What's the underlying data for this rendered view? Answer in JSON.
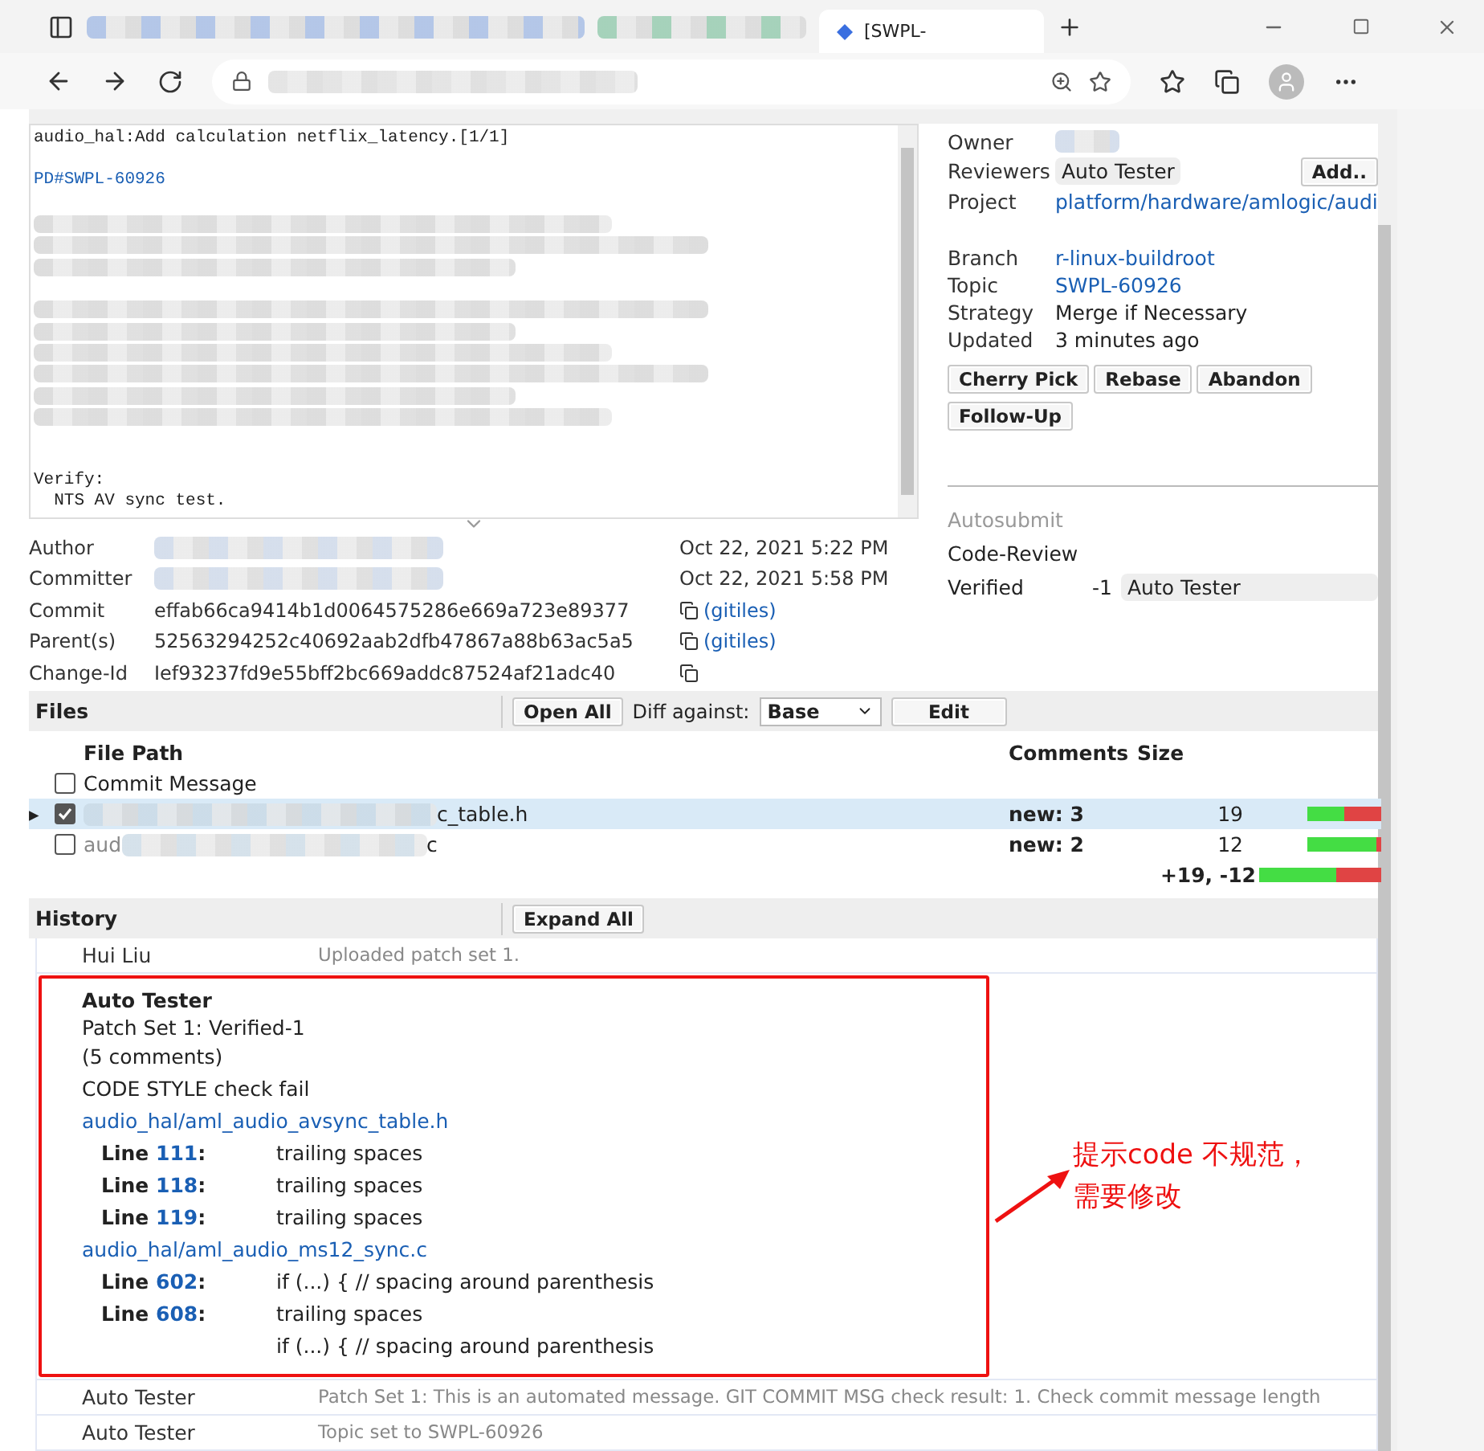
{
  "browser": {
    "tabs": [
      {
        "label": "[SWPL-",
        "selected": true
      }
    ]
  },
  "commit_message": {
    "lines": [
      {
        "kind": "text",
        "text": "audio_hal:Add calculation netflix_latency.[1/1]"
      },
      {
        "kind": "blank"
      },
      {
        "kind": "link",
        "text": "PD#SWPL-60926"
      },
      {
        "kind": "blank"
      },
      {
        "kind": "redacted"
      },
      {
        "kind": "redacted"
      },
      {
        "kind": "redacted"
      },
      {
        "kind": "blank"
      },
      {
        "kind": "redacted"
      },
      {
        "kind": "redacted"
      },
      {
        "kind": "redacted"
      },
      {
        "kind": "redacted"
      },
      {
        "kind": "redacted"
      },
      {
        "kind": "redacted"
      },
      {
        "kind": "blank"
      },
      {
        "kind": "blank"
      },
      {
        "kind": "text",
        "text": "Verify:"
      },
      {
        "kind": "text",
        "text": "  NTS AV sync test."
      }
    ]
  },
  "change_info": {
    "rows": [
      {
        "label": "Owner",
        "kind": "redacted"
      },
      {
        "label": "Reviewers",
        "kind": "chip",
        "value": "Auto Tester",
        "button": "Add.."
      },
      {
        "label": "Project",
        "kind": "link",
        "value": "platform/hardware/amlogic/audi"
      },
      {
        "kind": "blank"
      },
      {
        "label": "Branch",
        "kind": "link",
        "value": "r-linux-buildroot"
      },
      {
        "label": "Topic",
        "kind": "link",
        "value": "SWPL-60926"
      },
      {
        "label": "Strategy",
        "kind": "text",
        "value": "Merge if Necessary"
      },
      {
        "label": "Updated",
        "kind": "text",
        "value": "3 minutes ago"
      }
    ],
    "actions": [
      "Cherry Pick",
      "Rebase",
      "Abandon",
      "Follow-Up"
    ],
    "labels": [
      {
        "name": "Autosubmit",
        "disabled": true
      },
      {
        "name": "Code-Review",
        "disabled": false
      },
      {
        "name": "Verified",
        "disabled": false,
        "score": "-1",
        "voter": "Auto Tester"
      }
    ]
  },
  "commit_info": [
    {
      "label": "Author",
      "kind": "redacted",
      "date": "Oct 22, 2021 5:22 PM"
    },
    {
      "label": "Committer",
      "kind": "redacted",
      "date": "Oct 22, 2021 5:58 PM"
    },
    {
      "label": "Commit",
      "kind": "hash",
      "value": "effab66ca9414b1d0064575286e669a723e89377",
      "link": "(gitiles)"
    },
    {
      "label": "Parent(s)",
      "kind": "hash",
      "value": "52563294252c40692aab2dfb47867a88b63ac5a5",
      "link": "(gitiles)"
    },
    {
      "label": "Change-Id",
      "kind": "hash",
      "value": "Ief93237fd9e55bff2bc669addc87524af21adc40"
    }
  ],
  "files": {
    "title": "Files",
    "open_all": "Open All",
    "diff_label": "Diff against:",
    "diff_value": "Base",
    "edit": "Edit",
    "columns": [
      "File Path",
      "Comments",
      "Size"
    ],
    "rows": [
      {
        "path_tail": "Commit Message",
        "redacted": false,
        "checked": false,
        "selected": false
      },
      {
        "path_tail": "c_table.h",
        "redacted": true,
        "expander": "▸",
        "checked": true,
        "selected": true,
        "comments": "new: 3",
        "size": "19",
        "bar": {
          "level": 0.5
        }
      },
      {
        "path_head": "aud",
        "path_tail": "c",
        "redacted": true,
        "checked": false,
        "selected": false,
        "comments": "new: 2",
        "size": "12",
        "bar": {
          "level": 0.93
        }
      }
    ],
    "total": {
      "text": "+19, -12",
      "bar": {
        "level": 0.63
      }
    }
  },
  "history": {
    "title": "History",
    "expand_all": "Expand All",
    "messages": [
      {
        "author": "Hui Liu",
        "text": "Uploaded patch set 1.",
        "expanded": false
      },
      {
        "author": "Auto Tester",
        "expanded": true,
        "lines": [
          "Patch Set 1: Verified-1",
          "(5 comments)",
          "CODE STYLE check fail"
        ],
        "files": [
          {
            "path": "audio_hal/aml_audio_avsync_table.h",
            "comments": [
              {
                "prefix": "Line",
                "number": "111",
                "suffix": ":",
                "text": "trailing spaces"
              },
              {
                "prefix": "Line",
                "number": "118",
                "suffix": ":",
                "text": "trailing spaces"
              },
              {
                "prefix": "Line",
                "number": "119",
                "suffix": ":",
                "text": "trailing spaces"
              }
            ]
          },
          {
            "path": "audio_hal/aml_audio_ms12_sync.c",
            "comments": [
              {
                "prefix": "Line",
                "number": "602",
                "suffix": ":",
                "text": "if (...) {  // spacing around parenthesis"
              },
              {
                "prefix": "Line",
                "number": "608",
                "suffix": ":",
                "text": "trailing spaces"
              },
              {
                "text": "if (...) {  // spacing around parenthesis"
              }
            ]
          }
        ]
      },
      {
        "author": "Auto Tester",
        "text": "Patch Set 1: This is an automated message. GIT COMMIT MSG check result: 1. Check commit message length",
        "expanded": false
      },
      {
        "author": "Auto Tester",
        "text": "Topic set to SWPL-60926",
        "expanded": false
      }
    ]
  },
  "annotation": {
    "lines": [
      "提示code 不规范，",
      "需要修改"
    ]
  }
}
